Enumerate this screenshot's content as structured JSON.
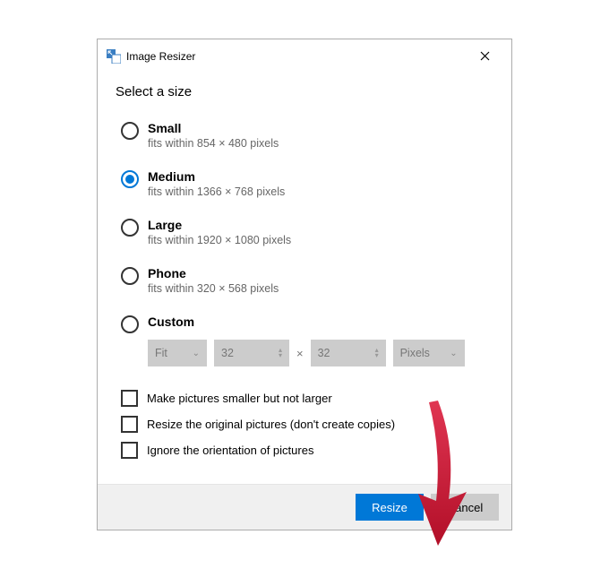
{
  "titlebar": {
    "app_title": "Image Resizer"
  },
  "subtitle": "Select a size",
  "size_options": [
    {
      "label": "Small",
      "desc": "fits within 854 × 480 pixels",
      "selected": false
    },
    {
      "label": "Medium",
      "desc": "fits within 1366 × 768 pixels",
      "selected": true
    },
    {
      "label": "Large",
      "desc": "fits within 1920 × 1080 pixels",
      "selected": false
    },
    {
      "label": "Phone",
      "desc": "fits within 320 × 568 pixels",
      "selected": false
    },
    {
      "label": "Custom",
      "desc": "",
      "selected": false
    }
  ],
  "custom": {
    "fit_label": "Fit",
    "width_value": "32",
    "times": "×",
    "height_value": "32",
    "unit_label": "Pixels"
  },
  "checkboxes": [
    "Make pictures smaller but not larger",
    "Resize the original pictures (don't create copies)",
    "Ignore the orientation of pictures"
  ],
  "buttons": {
    "resize": "Resize",
    "cancel": "Cancel"
  },
  "colors": {
    "accent": "#0078d7",
    "annotation": "#d21530"
  }
}
